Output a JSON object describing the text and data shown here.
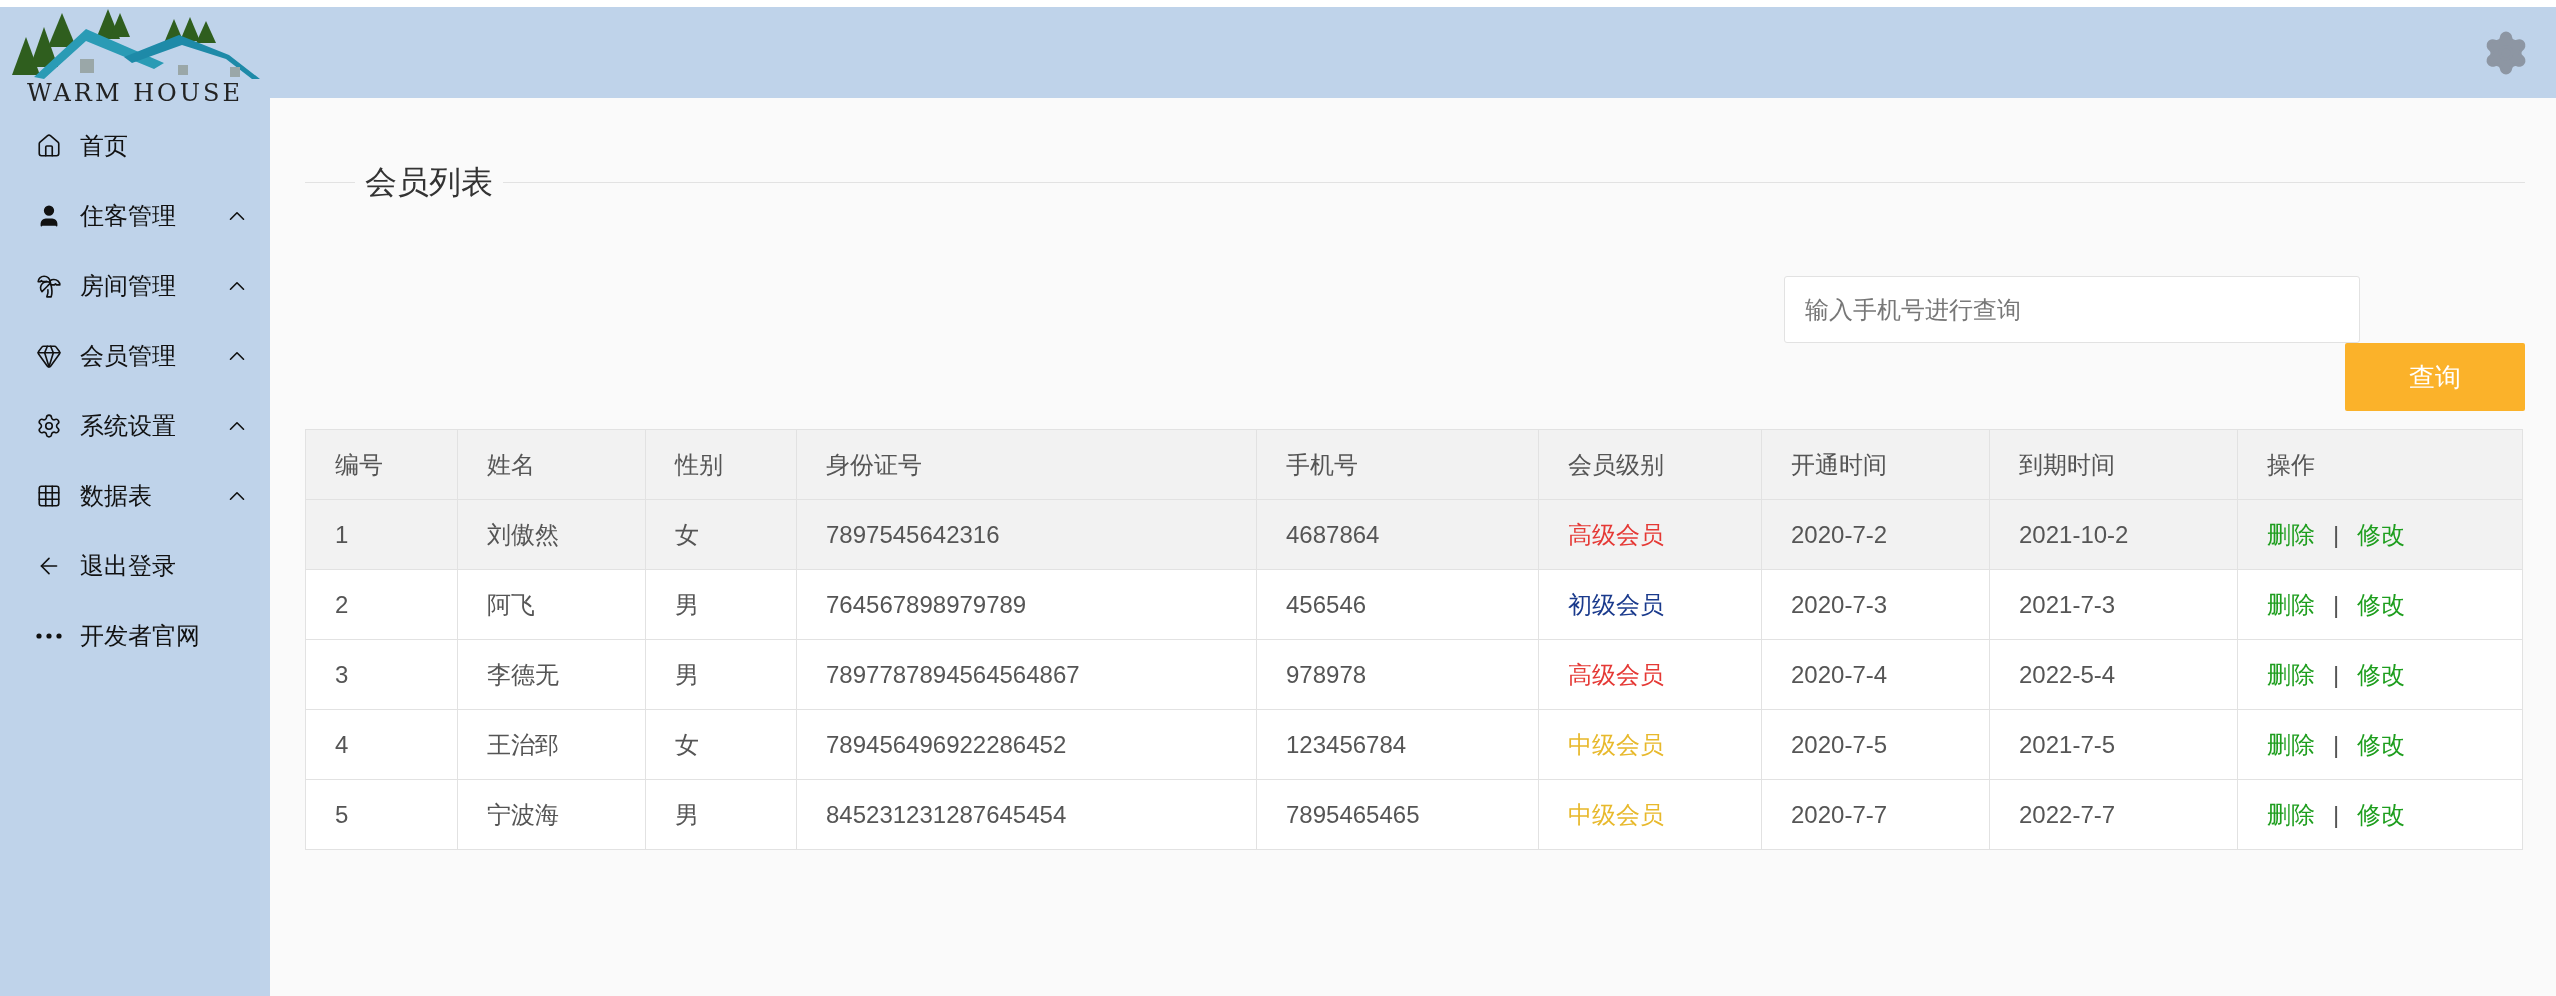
{
  "logo": {
    "text": "WARM HOUSE"
  },
  "sidebar": {
    "items": [
      {
        "label": "首页",
        "has_submenu": false
      },
      {
        "label": "住客管理",
        "has_submenu": true
      },
      {
        "label": "房间管理",
        "has_submenu": true
      },
      {
        "label": "会员管理",
        "has_submenu": true
      },
      {
        "label": "系统设置",
        "has_submenu": true
      },
      {
        "label": "数据表",
        "has_submenu": true
      },
      {
        "label": "退出登录",
        "has_submenu": false
      },
      {
        "label": "开发者官网",
        "has_submenu": false
      }
    ]
  },
  "page": {
    "title": "会员列表"
  },
  "search": {
    "placeholder": "输入手机号进行查询",
    "button": "查询"
  },
  "table": {
    "columns": [
      "编号",
      "姓名",
      "性别",
      "身份证号",
      "手机号",
      "会员级别",
      "开通时间",
      "到期时间",
      "操作"
    ],
    "rows": [
      {
        "highlighted": true,
        "id": "1",
        "name": "刘傲然",
        "gender": "女",
        "id_card": "7897545642316",
        "phone": "4687864",
        "level": {
          "text": "高级会员",
          "color": "#e53935"
        },
        "start": "2020-7-2",
        "end": "2021-10-2",
        "actions": [
          "删除",
          "|",
          "修改"
        ]
      },
      {
        "highlighted": false,
        "id": "2",
        "name": "阿飞",
        "gender": "男",
        "id_card": "764567898979789",
        "phone": "456546",
        "level": {
          "text": "初级会员",
          "color": "#1a3a8c"
        },
        "start": "2020-7-3",
        "end": "2021-7-3",
        "actions": [
          "删除",
          "|",
          "修改"
        ]
      },
      {
        "highlighted": false,
        "id": "3",
        "name": "李德无",
        "gender": "男",
        "id_card": "7897787894564564867",
        "phone": "978978",
        "level": {
          "text": "高级会员",
          "color": "#e53935"
        },
        "start": "2020-7-4",
        "end": "2022-5-4",
        "actions": [
          "删除",
          "|",
          "修改"
        ]
      },
      {
        "highlighted": false,
        "id": "4",
        "name": "王治郅",
        "gender": "女",
        "id_card": "789456496922286452",
        "phone": "123456784",
        "level": {
          "text": "中级会员",
          "color": "#e8b92c"
        },
        "start": "2020-7-5",
        "end": "2021-7-5",
        "actions": [
          "删除",
          "|",
          "修改"
        ]
      },
      {
        "highlighted": false,
        "id": "5",
        "name": "宁波海",
        "gender": "男",
        "id_card": "845231231287645454",
        "phone": "7895465465",
        "level": {
          "text": "中级会员",
          "color": "#e8b92c"
        },
        "start": "2020-7-7",
        "end": "2022-7-7",
        "actions": [
          "删除",
          "|",
          "修改"
        ]
      }
    ]
  }
}
